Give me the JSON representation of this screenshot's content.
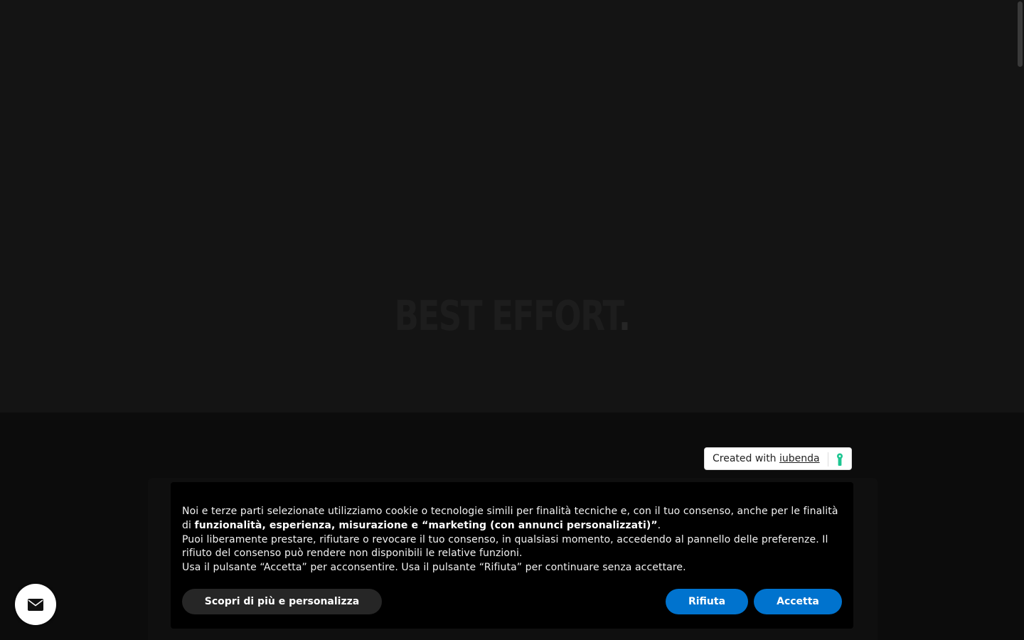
{
  "hero": {
    "logo_text": "BEST EFFORT",
    "logo_dot": "."
  },
  "badge": {
    "prefix": "Created with ",
    "link": "iubenda",
    "icon": "iubenda-keyhole-icon",
    "icon_color": "#1cc691"
  },
  "cookie_banner": {
    "line1_a": "Noi e terze parti selezionate utilizziamo cookie o tecnologie simili per finalità tecniche e, con il tuo consenso, anche per le finalità di ",
    "line1_bold": "funzionalità, esperienza, misurazione e “marketing (con annunci personalizzati)”",
    "line1_end": ".",
    "line2": "Puoi liberamente prestare, rifiutare o revocare il tuo consenso, in qualsiasi momento, accedendo al pannello delle preferenze. Il rifiuto del consenso può rendere non disponibili le relative funzioni.",
    "line3": "Usa il pulsante “Accetta” per acconsentire. Usa il pulsante “Rifiuta” per continuare senza accettare.",
    "customize_label": "Scopri di più e personalizza",
    "reject_label": "Rifiuta",
    "accept_label": "Accetta",
    "button_color": "#0073ce"
  },
  "contact_fab": {
    "icon": "envelope-icon"
  }
}
